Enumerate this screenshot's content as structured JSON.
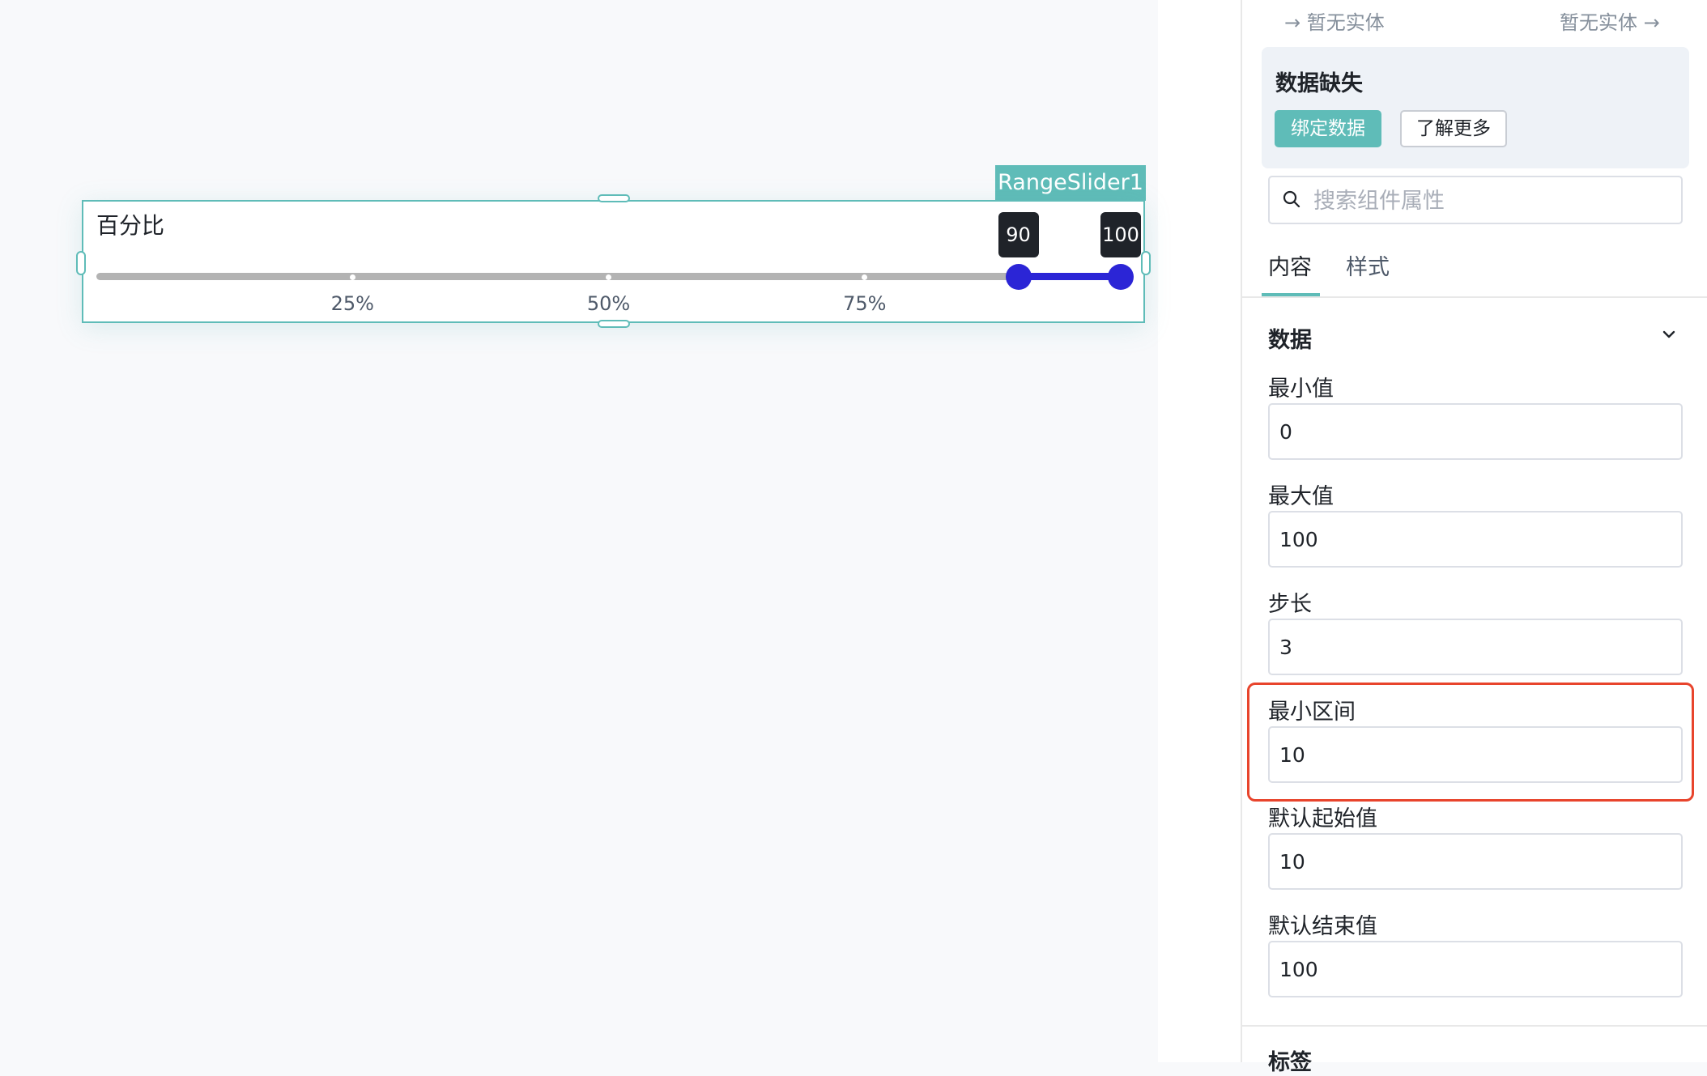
{
  "canvas": {
    "widget": {
      "tag": "RangeSlider1",
      "label": "百分比",
      "min": 0,
      "max": 100,
      "start_value": 90,
      "end_value": 100,
      "start_tip": "90",
      "end_tip": "100",
      "marks": [
        "25%",
        "50%",
        "75%"
      ],
      "accent_color": "#5fbcb8",
      "track_fill_color": "#2b25d6"
    }
  },
  "panel": {
    "entity_left": "暂无实体",
    "entity_right": "暂无实体",
    "notice": {
      "title": "数据缺失",
      "bind_button": "绑定数据",
      "learn_button": "了解更多"
    },
    "search_placeholder": "搜索组件属性",
    "tabs": [
      "内容",
      "样式"
    ],
    "active_tab": "内容",
    "section": {
      "title": "数据",
      "fields": [
        {
          "label": "最小值",
          "value": "0"
        },
        {
          "label": "最大值",
          "value": "100"
        },
        {
          "label": "步长",
          "value": "3"
        },
        {
          "label": "最小区间",
          "value": "10"
        },
        {
          "label": "默认起始值",
          "value": "10"
        },
        {
          "label": "默认结束值",
          "value": "100"
        }
      ]
    },
    "next_section_title": "标签",
    "highlight_color": "#e8442c"
  }
}
